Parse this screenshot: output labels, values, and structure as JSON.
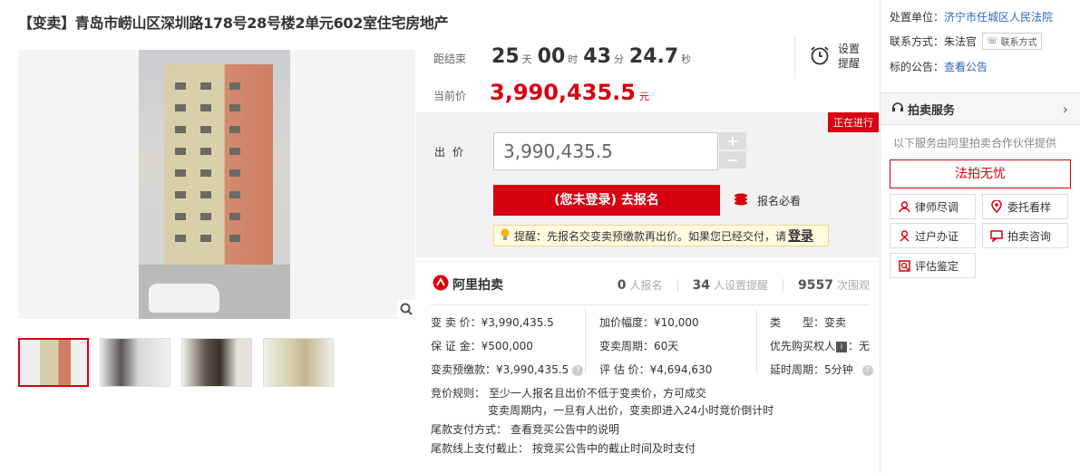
{
  "title": "【变卖】青岛市崂山区深圳路178号28号楼2单元602室住宅房地产",
  "countdown": {
    "label": "距结束",
    "days": "25",
    "days_unit": "天",
    "hours": "00",
    "hours_unit": "时",
    "minutes": "43",
    "minutes_unit": "分",
    "seconds": "24.7",
    "seconds_unit": "秒"
  },
  "current_price": {
    "label": "当前价",
    "value": "3,990,435.5",
    "unit": "元"
  },
  "remind": {
    "label": "设置提醒",
    "icon": "alarm-clock-icon"
  },
  "status_badge": "正在进行",
  "bid": {
    "label": "出价",
    "input_value": "3,990,435.5",
    "plus": "+",
    "minus": "−",
    "signup_button": "(您未登录) 去报名",
    "must_know": "报名必看",
    "tip_text": "提醒：先报名交变卖预缴款再出价。如果您已经交付，请",
    "tip_login": "登录"
  },
  "brand": "阿里拍卖",
  "stats": [
    {
      "num": "0",
      "label": "人报名"
    },
    {
      "num": "34",
      "label": "人设置提醒"
    },
    {
      "num": "9557",
      "label": "次围观"
    }
  ],
  "details": {
    "sell_price": "变 卖 价：¥3,990,435.5",
    "deposit": "保 证 金：¥500,000",
    "prepay": "变卖预缴款：¥3,990,435.5",
    "increment": "加价幅度：¥10,000",
    "period": "变卖周期：60天",
    "appraisal": "评 估 价：¥4,694,630",
    "type_label": "类　　型：",
    "type_value": "变卖",
    "priority_label": "优先购买权人",
    "priority_value": "：无",
    "delay": "延时周期：5分钟"
  },
  "rules": {
    "label": "竞价规则：",
    "line1": "至少一人报名且出价不低于变卖价，方可成交",
    "line2": "变卖周期内，一旦有人出价，变卖即进入24小时竞价倒计时",
    "tail_pay": "尾款支付方式：",
    "tail_pay_value": "查看竞买公告中的说明",
    "tail_online": "尾款线上支付截止：",
    "tail_online_value": "按竞买公告中的截止时间及时支付"
  },
  "sidebar": {
    "disposal_label": "处置单位：",
    "disposal_value": "济宁市任城区人民法院",
    "contact_label": "联系方式：",
    "contact_value": "朱法官",
    "contact_tag": "联系方式",
    "notice_label": "标的公告：",
    "notice_link": "查看公告",
    "service_title": "拍卖服务",
    "service_note": "以下服务由阿里拍卖合作伙伴提供",
    "fapai_button": "法拍无忧",
    "services": [
      {
        "label": "律师尽调",
        "icon": "lawyer-icon"
      },
      {
        "label": "委托看样",
        "icon": "location-pin-icon"
      },
      {
        "label": "过户办证",
        "icon": "transfer-icon"
      },
      {
        "label": "拍卖咨询",
        "icon": "chat-icon"
      },
      {
        "label": "评估鉴定",
        "icon": "appraisal-icon"
      }
    ]
  },
  "colors": {
    "accent": "#d7000f",
    "link": "#2c67c0"
  }
}
